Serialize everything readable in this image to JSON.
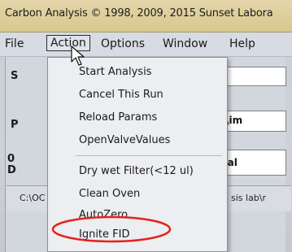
{
  "window": {
    "title": "Carbon Analysis © 1998, 2009, 2015 Sunset Labora"
  },
  "menubar": {
    "items": [
      "File",
      "Action",
      "Options",
      "Window",
      "Help"
    ],
    "active": "Action"
  },
  "background": {
    "letters": [
      "S",
      "P",
      "0",
      "D"
    ],
    "field_params": "eters\\im",
    "field_analysis": "on anal",
    "status_path": "C:\\OC",
    "status_path_right": "sis lab\\r"
  },
  "action_menu": {
    "items": [
      "Start Analysis",
      "Cancel This Run",
      "Reload Params",
      "OpenValveValues",
      "Dry wet Filter(<12 ul)",
      "Clean Oven",
      "AutoZero",
      "Ignite FID"
    ]
  },
  "colors": {
    "annotation_ring": "#e0251f",
    "title_bar": "#dccb93",
    "menu_bg": "#eceef1"
  },
  "icons": {
    "pointer": "mouse-pointer-icon"
  }
}
